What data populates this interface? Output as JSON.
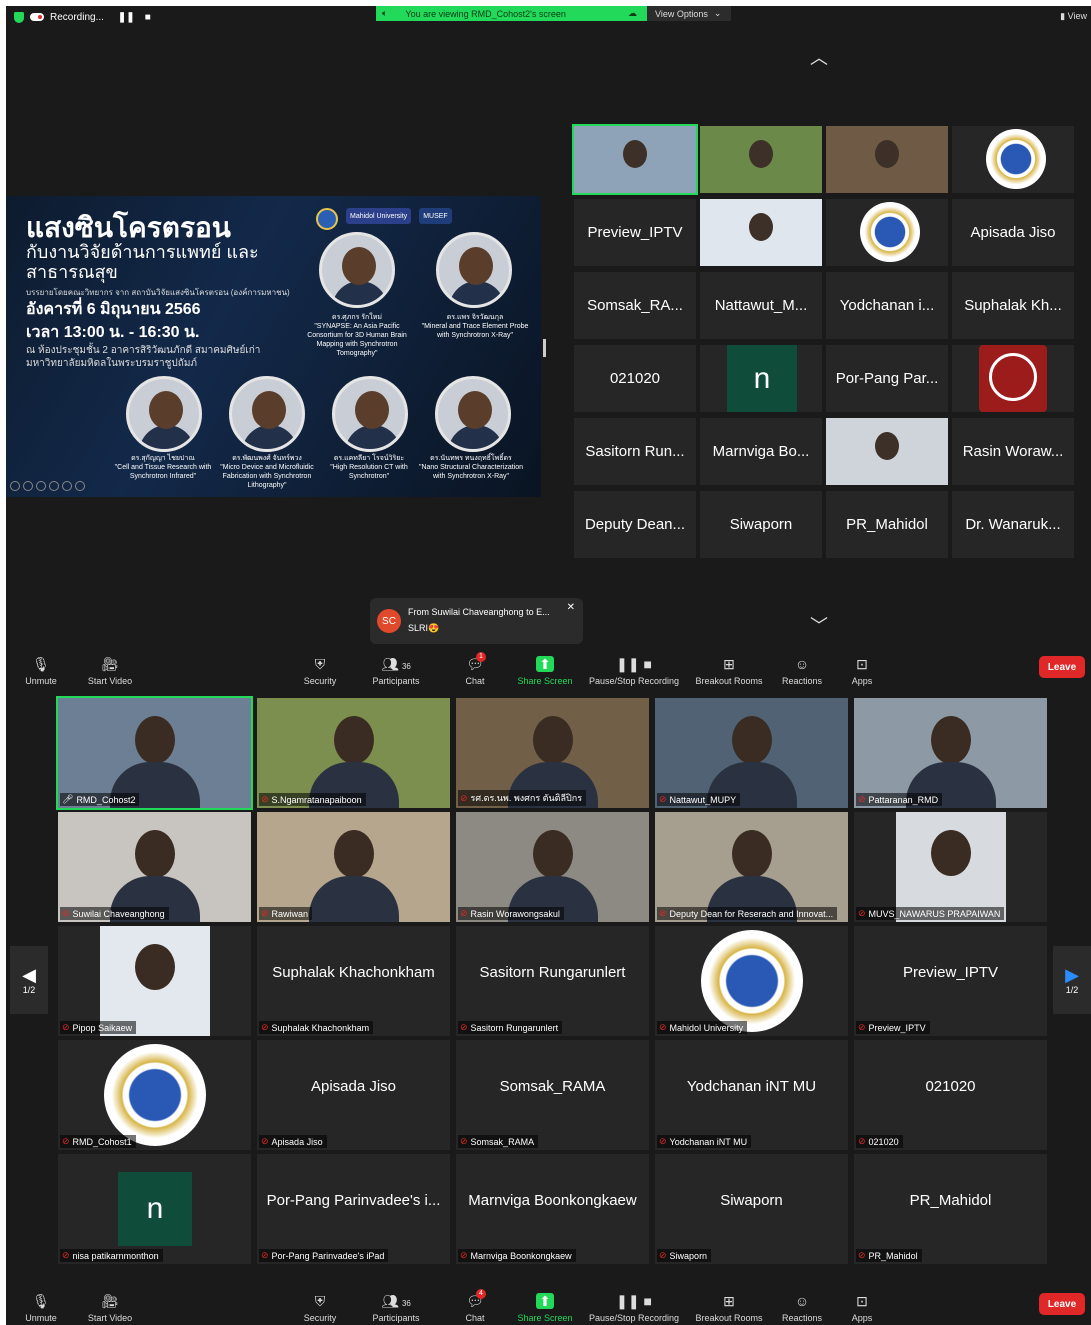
{
  "status": {
    "recording": "Recording...",
    "viewing": "You are viewing RMD_Cohost2's screen",
    "view_options": "View Options",
    "view": "View"
  },
  "slide": {
    "title1": "แสงซินโครตรอน",
    "title2": "กับงานวิจัยด้านการแพทย์ และสาธารณสุข",
    "organizer": "บรรยายโดยคณะวิทยากร จาก สถาบันวิจัยแสงซินโครตรอน (องค์การมหาชน)",
    "date": "อังคารที่ 6 มิถุนายน 2566",
    "time": "เวลา 13:00 น. - 16:30 น.",
    "venue": "ณ ห้องประชุมชั้น 2 อาคารสิริวัฒนภักดี สมาคมศิษย์เก่ามหาวิทยาลัยมหิดลในพระบรมราชูปถัมภ์",
    "logo1": "Mahidol University",
    "logo2": "MUSEF",
    "speakers": [
      {
        "name": "ดร.ศุภกร รักใหม่",
        "topic": "\"SYNAPSE: An Asia Pacific Consortium for 3D Human Brain Mapping with Synchrotron Tomography\""
      },
      {
        "name": "ดร.แพร จิรวัฒนกุล",
        "topic": "\"Mineral and Trace Element Probe with Synchrotron X-Ray\""
      },
      {
        "name": "ดร.สุกัญญา ไชยปาณ",
        "topic": "\"Cell and Tissue Research with Synchrotron Infrared\""
      },
      {
        "name": "ดร.พัฒนพงศ์ จันทร์พวง",
        "topic": "\"Micro Device and Microfluidic Fabrication with Synchrotron Lithography\""
      },
      {
        "name": "ดร.แคทลียา โรจน์วิริยะ",
        "topic": "\"High Resolution CT with Synchrotron\""
      },
      {
        "name": "ดร.นันทพร ทนงฤทธิ์โพธิ์ดร",
        "topic": "\"Nano Structural Characterization with Synchrotron X-Ray\""
      }
    ]
  },
  "top_grid": [
    {
      "label": "",
      "kind": "video",
      "color": "#8fa3b8"
    },
    {
      "label": "",
      "kind": "video",
      "color": "#6b8a4a"
    },
    {
      "label": "",
      "kind": "video",
      "color": "#6f5b45"
    },
    {
      "label": "",
      "kind": "seal"
    },
    {
      "label": "Preview_IPTV",
      "kind": "text"
    },
    {
      "label": "",
      "kind": "photo",
      "color": "#dfe6ee"
    },
    {
      "label": "",
      "kind": "seal"
    },
    {
      "label": "Apisada Jiso",
      "kind": "text"
    },
    {
      "label": "Somsak_RA...",
      "kind": "text"
    },
    {
      "label": "Nattawut_M...",
      "kind": "text"
    },
    {
      "label": "Yodchanan i...",
      "kind": "text"
    },
    {
      "label": "Suphalak Kh...",
      "kind": "text"
    },
    {
      "label": "021020",
      "kind": "text"
    },
    {
      "label": "n",
      "kind": "n"
    },
    {
      "label": "Por-Pang Par...",
      "kind": "text"
    },
    {
      "label": "",
      "kind": "redlogo"
    },
    {
      "label": "Sasitorn Run...",
      "kind": "text"
    },
    {
      "label": "Marnviga Bo...",
      "kind": "text"
    },
    {
      "label": "",
      "kind": "photo",
      "color": "#cfd4db"
    },
    {
      "label": "Rasin Woraw...",
      "kind": "text"
    },
    {
      "label": "Deputy Dean...",
      "kind": "text"
    },
    {
      "label": "Siwaporn",
      "kind": "text"
    },
    {
      "label": "PR_Mahidol",
      "kind": "text"
    },
    {
      "label": "Dr. Wanaruk...",
      "kind": "text"
    }
  ],
  "toast": {
    "initials": "SC",
    "from": "From Suwilai Chaveanghong to E...",
    "message": "SLRI😍"
  },
  "toolbar": {
    "unmute": "Unmute",
    "start_video": "Start Video",
    "security": "Security",
    "participants": "Participants",
    "participants_count": "36",
    "chat": "Chat",
    "chat_badge_top": "1",
    "chat_badge_bottom": "4",
    "share_screen": "Share Screen",
    "pause_stop_recording": "Pause/Stop Recording",
    "breakout_rooms": "Breakout Rooms",
    "reactions": "Reactions",
    "apps": "Apps",
    "leave": "Leave"
  },
  "gallery": [
    {
      "label": "RMD_Cohost2",
      "name": "",
      "kind": "video",
      "color": "#6d7f94",
      "active": true,
      "mic": "on"
    },
    {
      "label": "S.Ngamratanapaiboon",
      "name": "",
      "kind": "video",
      "color": "#7d8f4e",
      "mic": "off"
    },
    {
      "label": "รศ.ดร.นพ. พงศกร ตันติลีปิกร",
      "name": "",
      "kind": "video",
      "color": "#725f48",
      "mic": "off"
    },
    {
      "label": "Nattawut_MUPY",
      "name": "",
      "kind": "video",
      "color": "#526275",
      "mic": "off"
    },
    {
      "label": "Pattaranan_RMD",
      "name": "",
      "kind": "video",
      "color": "#8d9aa6",
      "mic": "off"
    },
    {
      "label": "Suwilai Chaveanghong",
      "name": "",
      "kind": "video",
      "color": "#c8c5c0",
      "mic": "off"
    },
    {
      "label": "Rawiwan",
      "name": "",
      "kind": "video",
      "color": "#b7a68e",
      "mic": "off"
    },
    {
      "label": "Rasin Worawongsakul",
      "name": "",
      "kind": "video",
      "color": "#8d8a84",
      "mic": "off"
    },
    {
      "label": "Deputy Dean for Reserach and Innovat...",
      "name": "",
      "kind": "video",
      "color": "#a69e8e",
      "mic": "off"
    },
    {
      "label": "MUVS_NAWARUS PRAPAIWAN",
      "name": "",
      "kind": "photo",
      "color": "#d7dbe0",
      "mic": "off"
    },
    {
      "label": "Pipop Saikaew",
      "name": "",
      "kind": "photo",
      "color": "#e3e8ee",
      "mic": "off"
    },
    {
      "label": "Suphalak Khachonkham",
      "name": "Suphalak Khachonkham",
      "kind": "text",
      "mic": "off"
    },
    {
      "label": "Sasitorn Rungarunlert",
      "name": "Sasitorn Rungarunlert",
      "kind": "text",
      "mic": "off"
    },
    {
      "label": "Mahidol University",
      "name": "",
      "kind": "seal",
      "mic": "off"
    },
    {
      "label": "Preview_IPTV",
      "name": "Preview_IPTV",
      "kind": "text",
      "mic": "off"
    },
    {
      "label": "RMD_Cohost1",
      "name": "",
      "kind": "seal",
      "mic": "off"
    },
    {
      "label": "Apisada Jiso",
      "name": "Apisada Jiso",
      "kind": "text",
      "mic": "off"
    },
    {
      "label": "Somsak_RAMA",
      "name": "Somsak_RAMA",
      "kind": "text",
      "mic": "off"
    },
    {
      "label": "Yodchanan iNT MU",
      "name": "Yodchanan iNT MU",
      "kind": "text",
      "mic": "off"
    },
    {
      "label": "021020",
      "name": "021020",
      "kind": "text",
      "mic": "off"
    },
    {
      "label": "nisa patikarnmonthon",
      "name": "n",
      "kind": "n",
      "mic": "off"
    },
    {
      "label": "Por-Pang Parinvadee's iPad",
      "name": "Por-Pang Parinvadee's i...",
      "kind": "text",
      "mic": "off"
    },
    {
      "label": "Marnviga Boonkongkaew",
      "name": "Marnviga Boonkongkaew",
      "kind": "text",
      "mic": "off"
    },
    {
      "label": "Siwaporn",
      "name": "Siwaporn",
      "kind": "text",
      "mic": "off"
    },
    {
      "label": "PR_Mahidol",
      "name": "PR_Mahidol",
      "kind": "text",
      "mic": "off"
    }
  ],
  "pager": {
    "left": "1/2",
    "right": "1/2"
  },
  "colors": {
    "active_border": "#23d959",
    "leave": "#e02828",
    "share": "#23d959"
  }
}
